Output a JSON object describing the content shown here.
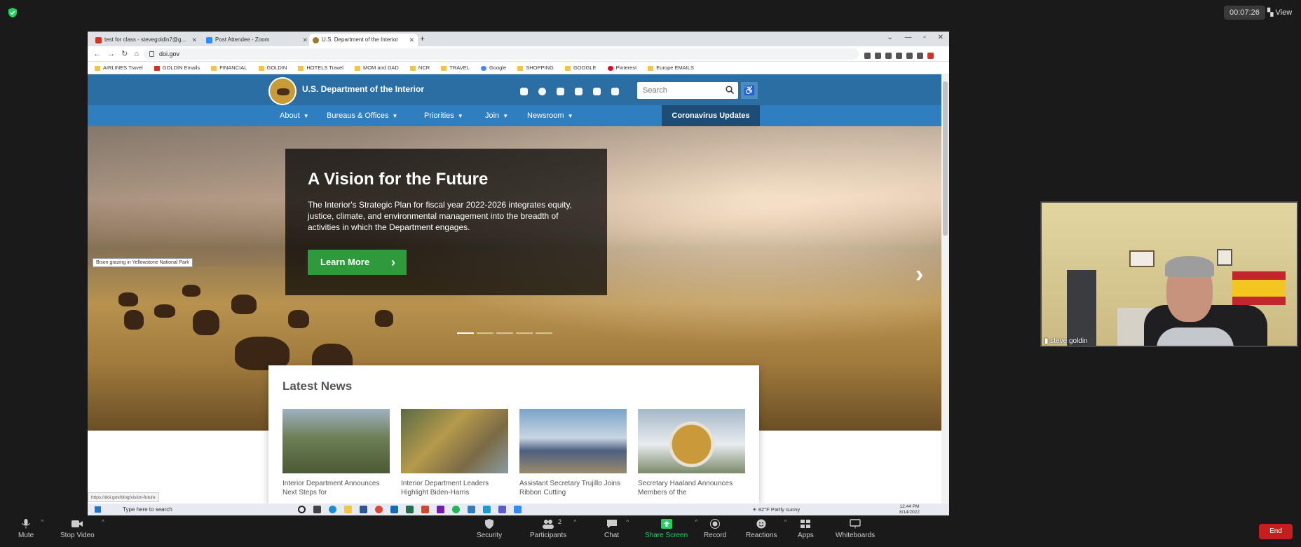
{
  "zoom": {
    "timer": "00:07:26",
    "view_label": "View",
    "toolbar": {
      "mute": "Mute",
      "stop_video": "Stop Video",
      "security": "Security",
      "participants": "Participants",
      "participants_count": "2",
      "chat": "Chat",
      "share_screen": "Share Screen",
      "record": "Record",
      "reactions": "Reactions",
      "apps": "Apps",
      "whiteboards": "Whiteboards",
      "end": "End"
    },
    "participant_name": "steve goldin"
  },
  "browser": {
    "tabs": [
      {
        "label": "test for class - stevegoldin7@g...",
        "favicon_color": "#d93025"
      },
      {
        "label": "Post Attendee - Zoom",
        "favicon_color": "#2d8cff"
      },
      {
        "label": "U.S. Department of the Interior",
        "favicon_color": "#9c7a2c"
      }
    ],
    "url": "doi.gov",
    "bookmarks": [
      "AIRLINES Travel",
      "GOLDIN Emails",
      "FINANCIAL",
      "GOLDIN",
      "HOTELS Travel",
      "MOM and DAD",
      "NCR",
      "TRAVEL",
      "Google",
      "SHOPPING",
      "GOOGLE",
      "Pinterest",
      "Europe EMAILS"
    ],
    "status_url": "https://doi.gov/blog/vision-future"
  },
  "doi": {
    "site_title": "U.S. Department of the Interior",
    "search_placeholder": "Search",
    "nav": [
      "About",
      "Bureaus & Offices",
      "Priorities",
      "Join",
      "Newsroom"
    ],
    "covid_label": "Coronavirus Updates",
    "hero": {
      "title": "A Vision for the Future",
      "text": "The Interior's Strategic Plan for fiscal year 2022-2026 integrates equity, justice, climate, and environmental management into the breadth of activities in which the Department engages.",
      "button": "Learn More",
      "caption": "Bison grazing in Yellowstone National Park"
    },
    "news": {
      "title": "Latest News",
      "items": [
        {
          "caption": "Interior Department Announces Next Steps for",
          "color": "#6d7f55"
        },
        {
          "caption": "Interior Department Leaders Highlight Biden-Harris",
          "color": "#7b6a45"
        },
        {
          "caption": "Assistant Secretary Trujillo Joins Ribbon Cutting",
          "color": "#7aa3c9"
        },
        {
          "caption": "Secretary Haaland Announces Members of the",
          "color": "#a5b7c8"
        }
      ]
    }
  },
  "taskbar": {
    "search_placeholder": "Type here to search",
    "weather": "82°F  Partly sunny",
    "time": "12:44 PM",
    "date": "8/14/2022"
  }
}
